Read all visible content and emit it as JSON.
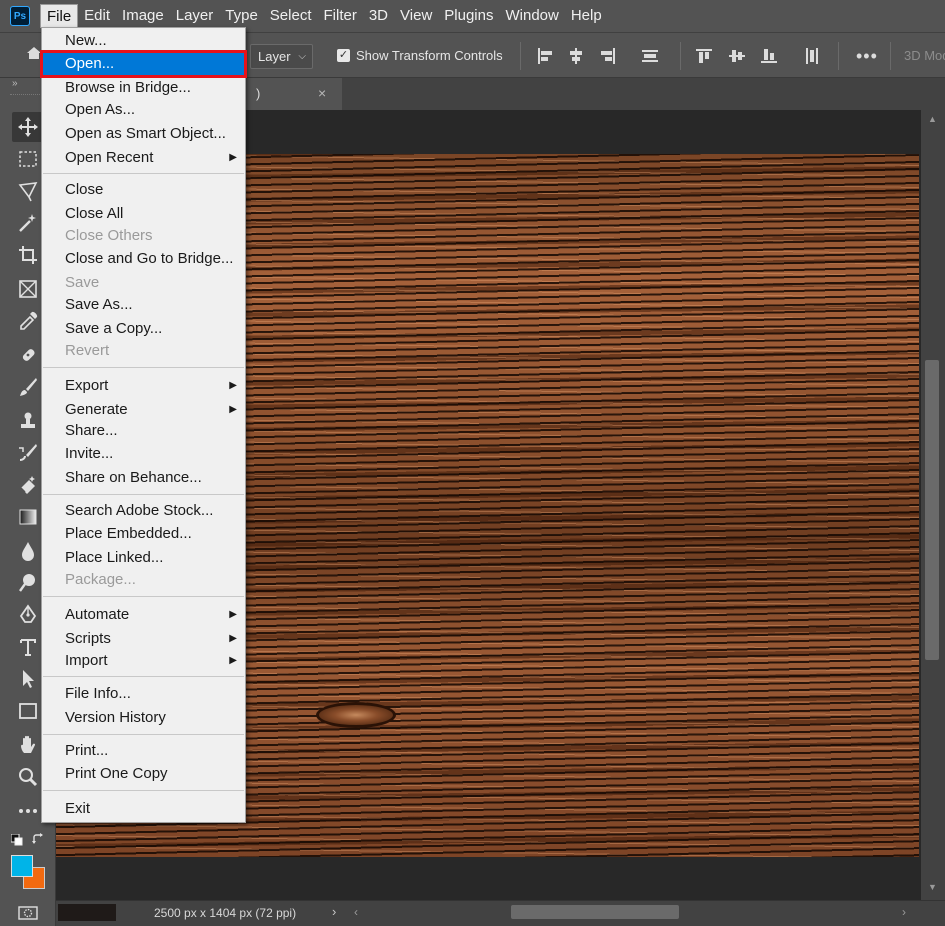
{
  "menubar": {
    "logo": "Ps",
    "items": [
      "File",
      "Edit",
      "Image",
      "Layer",
      "Type",
      "Select",
      "Filter",
      "3D",
      "View",
      "Plugins",
      "Window",
      "Help"
    ],
    "active": "File"
  },
  "options": {
    "layer_select": "Layer",
    "show_transform_controls": "Show Transform Controls",
    "show_transform_checked": true,
    "mode_3d": "3D Mod",
    "more": "•••"
  },
  "document": {
    "tab_title": ")",
    "tab_close": "×"
  },
  "status": {
    "info": "2500 px x 1404 px (72 ppi)",
    "chevron": "›"
  },
  "file_menu": {
    "items": [
      {
        "label": "New...",
        "enabled": true
      },
      {
        "label": "Open...",
        "enabled": true,
        "highlighted": true
      },
      {
        "label": "Browse in Bridge...",
        "enabled": true
      },
      {
        "label": "Open As...",
        "enabled": true
      },
      {
        "label": "Open as Smart Object...",
        "enabled": true
      },
      {
        "label": "Open Recent",
        "enabled": true,
        "submenu": true
      },
      {
        "label": "Close",
        "enabled": true
      },
      {
        "label": "Close All",
        "enabled": true
      },
      {
        "label": "Close Others",
        "enabled": false
      },
      {
        "label": "Close and Go to Bridge...",
        "enabled": true
      },
      {
        "label": "Save",
        "enabled": false
      },
      {
        "label": "Save As...",
        "enabled": true
      },
      {
        "label": "Save a Copy...",
        "enabled": true
      },
      {
        "label": "Revert",
        "enabled": false
      },
      {
        "label": "Export",
        "enabled": true,
        "submenu": true
      },
      {
        "label": "Generate",
        "enabled": true,
        "submenu": true
      },
      {
        "label": "Share...",
        "enabled": true
      },
      {
        "label": "Invite...",
        "enabled": true
      },
      {
        "label": "Share on Behance...",
        "enabled": true
      },
      {
        "label": "Search Adobe Stock...",
        "enabled": true
      },
      {
        "label": "Place Embedded...",
        "enabled": true
      },
      {
        "label": "Place Linked...",
        "enabled": true
      },
      {
        "label": "Package...",
        "enabled": false
      },
      {
        "label": "Automate",
        "enabled": true,
        "submenu": true
      },
      {
        "label": "Scripts",
        "enabled": true,
        "submenu": true
      },
      {
        "label": "Import",
        "enabled": true,
        "submenu": true
      },
      {
        "label": "File Info...",
        "enabled": true
      },
      {
        "label": "Version History",
        "enabled": true
      },
      {
        "label": "Print...",
        "enabled": true
      },
      {
        "label": "Print One Copy",
        "enabled": true
      },
      {
        "label": "Exit",
        "enabled": true
      }
    ]
  },
  "colors": {
    "foreground": "#00b4e8",
    "background": "#f26a10",
    "highlight": "#0078d7",
    "callout": "#e8121b"
  },
  "tools": [
    "move-tool-icon",
    "marquee-tool-icon",
    "lasso-tool-icon",
    "magic-wand-icon",
    "crop-tool-icon",
    "frame-tool-icon",
    "eyedropper-icon",
    "healing-brush-icon",
    "brush-tool-icon",
    "clone-stamp-icon",
    "history-brush-icon",
    "eraser-icon",
    "gradient-tool-icon",
    "blur-tool-icon",
    "dodge-tool-icon",
    "pen-tool-icon",
    "type-tool-icon",
    "path-selection-icon",
    "rectangle-tool-icon",
    "hand-tool-icon",
    "zoom-tool-icon",
    "more-tools-icon"
  ]
}
